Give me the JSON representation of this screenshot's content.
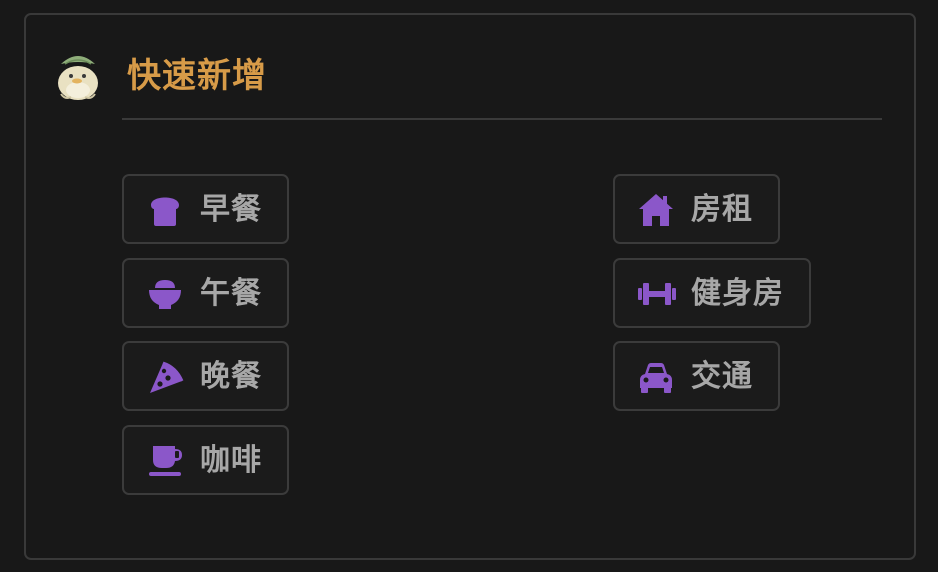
{
  "panel": {
    "title": "快速新增",
    "avatar_icon": "duck-mascot-icon"
  },
  "colors": {
    "accent_icon": "#8b57c9",
    "title": "#d79b48",
    "label": "#a7a7a7",
    "background": "#181818",
    "border": "#3b3b3b"
  },
  "buttons": [
    {
      "label": "早餐",
      "icon": "bread-icon"
    },
    {
      "label": "午餐",
      "icon": "rice-bowl-icon"
    },
    {
      "label": "晚餐",
      "icon": "pizza-slice-icon"
    },
    {
      "label": "咖啡",
      "icon": "coffee-cup-icon"
    },
    {
      "label": "房租",
      "icon": "house-icon"
    },
    {
      "label": "健身房",
      "icon": "dumbbell-icon"
    },
    {
      "label": "交通",
      "icon": "car-icon"
    }
  ]
}
